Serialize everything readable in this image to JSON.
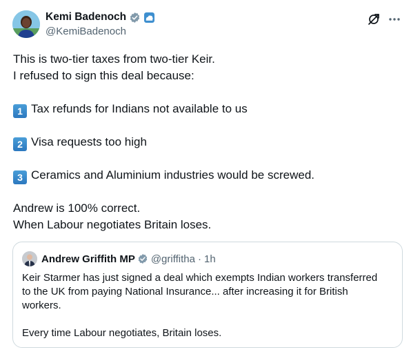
{
  "post": {
    "author_name": "Kemi Badenoch",
    "author_handle": "@KemiBadenoch",
    "lines": [
      "This is two-tier taxes from two-tier Keir.",
      "I refused to sign this deal because:"
    ],
    "points": [
      {
        "number": "1",
        "text": "Tax refunds for Indians not available to us"
      },
      {
        "number": "2",
        "text": "Visa requests too high"
      },
      {
        "number": "3",
        "text": "Ceramics and Aluminium industries would be screwed."
      }
    ],
    "closing": [
      "Andrew is 100% correct.",
      "When Labour negotiates Britain loses."
    ]
  },
  "quote": {
    "author_name": "Andrew Griffith MP",
    "author_handle": "@griffitha",
    "separator": "·",
    "time": "1h",
    "lines": [
      "Keir Starmer has just signed a deal which exempts Indian workers transferred",
      "to the UK from paying National Insurance... after increasing it for British",
      "workers.",
      "",
      "Every time Labour negotiates, Britain loses."
    ]
  },
  "icons": {
    "verified": "verified-badge-icon",
    "affiliation": "government-affiliation-icon",
    "grok": "grok-icon",
    "more": "more-options-icon"
  },
  "colors": {
    "verified": "#829aab",
    "text": "#0f1419",
    "secondary": "#536471",
    "number_badge": "#3b8bd0"
  }
}
